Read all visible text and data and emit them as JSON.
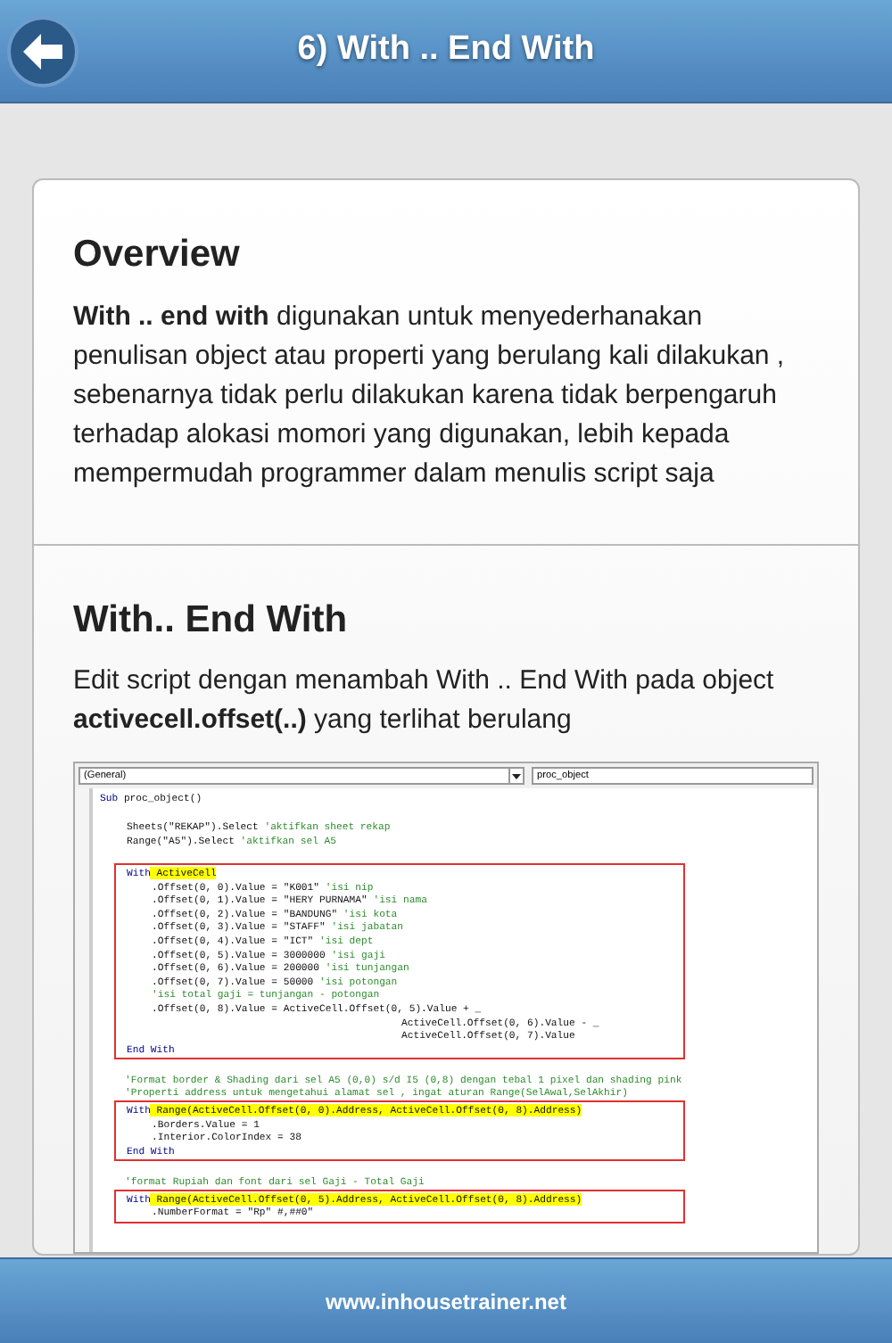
{
  "header": {
    "title": "6) With .. End With"
  },
  "sections": [
    {
      "kind": "text",
      "heading": "Overview",
      "body": "**With .. end with** digunakan untuk menyederhanakan penulisan object atau properti yang berulang kali dilakukan , sebenarnya tidak perlu dilakukan karena tidak berpengaruh terhadap alokasi momori yang digunakan, lebih kepada mempermudah programmer dalam menulis script saja"
    },
    {
      "kind": "code",
      "heading": "With.. End With",
      "body": "Edit script dengan menambah With .. End With pada object **activecell.offset(..)** yang terlihat berulang",
      "code_window": {
        "object_combo": "(General)",
        "proc_combo": "proc_object",
        "sub_line": [
          {
            "kind": "keyword",
            "text": "Sub"
          },
          {
            "kind": "plain",
            "text": "proc_object()"
          }
        ],
        "blocks": [
          {
            "boxed": false,
            "lines": [
              {
                "parts": [
                  {
                    "kind": "plain",
                    "text": "Sheets(\"REKAP\").Select"
                  },
                  {
                    "kind": "comment",
                    "text": "'aktifkan sheet rekap"
                  }
                ]
              },
              {
                "parts": [
                  {
                    "kind": "plain",
                    "text": "Range(\"A5\").Select"
                  },
                  {
                    "kind": "comment",
                    "text": "'aktifkan sel A5"
                  }
                ]
              }
            ]
          },
          {
            "boxed": true,
            "lines": [
              {
                "parts": [
                  {
                    "kind": "keyword",
                    "text": "With"
                  },
                  {
                    "kind": "highlight",
                    "text": "ActiveCell"
                  }
                ],
                "children": [
                  {
                    "parts": [
                      {
                        "kind": "plain",
                        "text": ".Offset(0, 0).Value = \"K001\""
                      },
                      {
                        "kind": "comment",
                        "text": "'isi nip"
                      }
                    ]
                  },
                  {
                    "parts": [
                      {
                        "kind": "plain",
                        "text": ".Offset(0, 1).Value = \"HERY PURNAMA\""
                      },
                      {
                        "kind": "comment",
                        "text": "'isi nama"
                      }
                    ]
                  },
                  {
                    "parts": [
                      {
                        "kind": "plain",
                        "text": ".Offset(0, 2).Value = \"BANDUNG\""
                      },
                      {
                        "kind": "comment",
                        "text": "'isi kota"
                      }
                    ]
                  },
                  {
                    "parts": [
                      {
                        "kind": "plain",
                        "text": ".Offset(0, 3).Value = \"STAFF\""
                      },
                      {
                        "kind": "comment",
                        "text": "'isi jabatan"
                      }
                    ]
                  },
                  {
                    "parts": [
                      {
                        "kind": "plain",
                        "text": ".Offset(0, 4).Value = \"ICT\""
                      },
                      {
                        "kind": "comment",
                        "text": "'isi dept"
                      }
                    ]
                  },
                  {
                    "parts": [
                      {
                        "kind": "plain",
                        "text": ".Offset(0, 5).Value = 3000000"
                      },
                      {
                        "kind": "comment",
                        "text": "'isi gaji"
                      }
                    ]
                  },
                  {
                    "parts": [
                      {
                        "kind": "plain",
                        "text": ".Offset(0, 6).Value = 200000"
                      },
                      {
                        "kind": "comment",
                        "text": "'isi tunjangan"
                      }
                    ]
                  },
                  {
                    "parts": [
                      {
                        "kind": "plain",
                        "text": ".Offset(0, 7).Value = 50000"
                      },
                      {
                        "kind": "comment",
                        "text": "'isi potongan"
                      }
                    ]
                  },
                  {
                    "parts": [
                      {
                        "kind": "comment",
                        "text": "'isi total gaji = tunjangan - potongan"
                      }
                    ]
                  },
                  {
                    "parts": [
                      {
                        "kind": "plain",
                        "text": ".Offset(0, 8).Value = ActiveCell.Offset(0, 5).Value + _"
                      }
                    ],
                    "children": [
                      {
                        "parts": [
                          {
                            "kind": "plain",
                            "text": "ActiveCell.Offset(0, 6).Value - _"
                          }
                        ]
                      },
                      {
                        "parts": [
                          {
                            "kind": "plain",
                            "text": "ActiveCell.Offset(0, 7).Value"
                          }
                        ]
                      }
                    ]
                  }
                ]
              },
              {
                "parts": [
                  {
                    "kind": "keyword",
                    "text": "End With"
                  }
                ]
              }
            ]
          },
          {
            "boxed": true,
            "comments": [
              "'Format border & Shading dari sel A5 (0,0) s/d I5 (0,8) dengan tebal 1 pixel dan shading pink",
              "'Properti address untuk mengetahui alamat sel , ingat aturan Range(SelAwal,SelAkhir)"
            ],
            "lines": [
              {
                "parts": [
                  {
                    "kind": "keyword",
                    "text": "With"
                  },
                  {
                    "kind": "highlight",
                    "text": "Range(ActiveCell.Offset(0, 0).Address, ActiveCell.Offset(0, 8).Address)"
                  }
                ],
                "children": [
                  {
                    "parts": [
                      {
                        "kind": "plain",
                        "text": ".Borders.Value = 1"
                      }
                    ]
                  },
                  {
                    "parts": [
                      {
                        "kind": "plain",
                        "text": ".Interior.ColorIndex = 38"
                      }
                    ]
                  }
                ]
              },
              {
                "parts": [
                  {
                    "kind": "keyword",
                    "text": "End With"
                  }
                ]
              }
            ]
          },
          {
            "boxed": true,
            "comments": [
              "'format Rupiah dan font dari sel Gaji - Total Gaji"
            ],
            "lines": [
              {
                "parts": [
                  {
                    "kind": "keyword",
                    "text": "With"
                  },
                  {
                    "kind": "highlight",
                    "text": "Range(ActiveCell.Offset(0, 5).Address, ActiveCell.Offset(0, 8).Address)"
                  }
                ],
                "children": [
                  {
                    "parts": [
                      {
                        "kind": "plain",
                        "text": ".NumberFormat = \"Rp\" #,##0\""
                      }
                    ]
                  }
                ]
              }
            ]
          }
        ]
      }
    }
  ],
  "footer": {
    "text": "www.inhousetrainer.net"
  }
}
